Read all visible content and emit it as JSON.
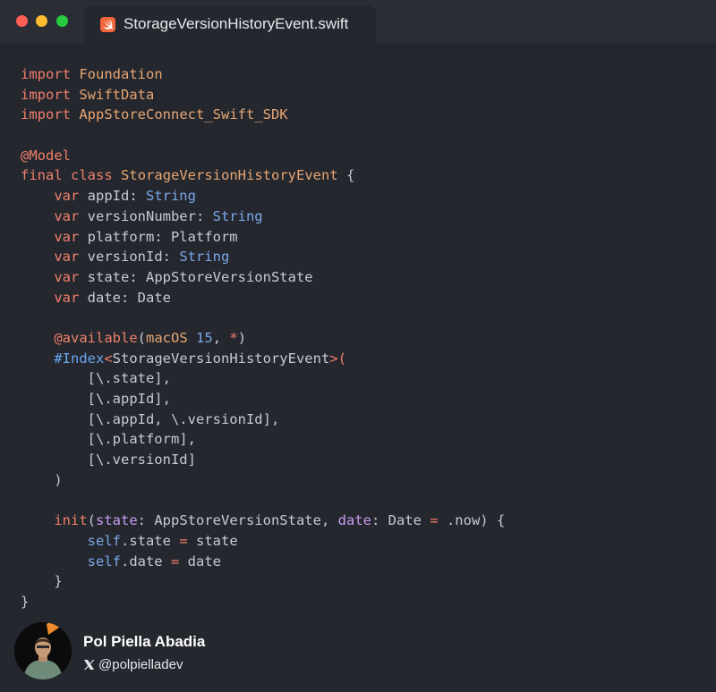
{
  "window": {
    "tab_title": "StorageVersionHistoryEvent.swift",
    "tab_icon": "swift-icon"
  },
  "code": {
    "lines": [
      [
        {
          "t": "import",
          "c": "kw"
        },
        {
          "t": " "
        },
        {
          "t": "Foundation",
          "c": "imp"
        }
      ],
      [
        {
          "t": "import",
          "c": "kw"
        },
        {
          "t": " "
        },
        {
          "t": "SwiftData",
          "c": "imp"
        }
      ],
      [
        {
          "t": "import",
          "c": "kw"
        },
        {
          "t": " "
        },
        {
          "t": "AppStoreConnect_Swift_SDK",
          "c": "imp"
        }
      ],
      [],
      [
        {
          "t": "@Model",
          "c": "attr"
        }
      ],
      [
        {
          "t": "final",
          "c": "kw"
        },
        {
          "t": " "
        },
        {
          "t": "class",
          "c": "kw"
        },
        {
          "t": " "
        },
        {
          "t": "StorageVersionHistoryEvent",
          "c": "imp"
        },
        {
          "t": " {"
        }
      ],
      [
        {
          "t": "    "
        },
        {
          "t": "var",
          "c": "kw"
        },
        {
          "t": " appId: "
        },
        {
          "t": "String",
          "c": "ty"
        }
      ],
      [
        {
          "t": "    "
        },
        {
          "t": "var",
          "c": "kw"
        },
        {
          "t": " versionNumber: "
        },
        {
          "t": "String",
          "c": "ty"
        }
      ],
      [
        {
          "t": "    "
        },
        {
          "t": "var",
          "c": "kw"
        },
        {
          "t": " platform: Platform"
        }
      ],
      [
        {
          "t": "    "
        },
        {
          "t": "var",
          "c": "kw"
        },
        {
          "t": " versionId: "
        },
        {
          "t": "String",
          "c": "ty"
        }
      ],
      [
        {
          "t": "    "
        },
        {
          "t": "var",
          "c": "kw"
        },
        {
          "t": " state: AppStoreVersionState"
        }
      ],
      [
        {
          "t": "    "
        },
        {
          "t": "var",
          "c": "kw"
        },
        {
          "t": " date: Date"
        }
      ],
      [],
      [
        {
          "t": "    "
        },
        {
          "t": "@available",
          "c": "attr"
        },
        {
          "t": "("
        },
        {
          "t": "macOS",
          "c": "imp"
        },
        {
          "t": " "
        },
        {
          "t": "15",
          "c": "ty"
        },
        {
          "t": ", "
        },
        {
          "t": "*",
          "c": "op"
        },
        {
          "t": ")"
        }
      ],
      [
        {
          "t": "    "
        },
        {
          "t": "#Index",
          "c": "idx"
        },
        {
          "t": "<",
          "c": "op"
        },
        {
          "t": "StorageVersionHistoryEvent"
        },
        {
          "t": ">(",
          "c": "op"
        }
      ],
      [
        {
          "t": "        [\\.state],"
        }
      ],
      [
        {
          "t": "        [\\.appId],"
        }
      ],
      [
        {
          "t": "        [\\.appId, \\.versionId],"
        }
      ],
      [
        {
          "t": "        [\\.platform],"
        }
      ],
      [
        {
          "t": "        [\\.versionId]"
        }
      ],
      [
        {
          "t": "    )"
        }
      ],
      [],
      [
        {
          "t": "    "
        },
        {
          "t": "init",
          "c": "kw"
        },
        {
          "t": "("
        },
        {
          "t": "state",
          "c": "lbl"
        },
        {
          "t": ": AppStoreVersionState, "
        },
        {
          "t": "date",
          "c": "lbl"
        },
        {
          "t": ": Date "
        },
        {
          "t": "=",
          "c": "op"
        },
        {
          "t": " .now) {"
        }
      ],
      [
        {
          "t": "        "
        },
        {
          "t": "self",
          "c": "ty"
        },
        {
          "t": ".state "
        },
        {
          "t": "=",
          "c": "op"
        },
        {
          "t": " state"
        }
      ],
      [
        {
          "t": "        "
        },
        {
          "t": "self",
          "c": "ty"
        },
        {
          "t": ".date "
        },
        {
          "t": "=",
          "c": "op"
        },
        {
          "t": " date"
        }
      ],
      [
        {
          "t": "    }"
        }
      ],
      [
        {
          "t": "}"
        }
      ]
    ]
  },
  "author": {
    "name": "Pol Piella Abadia",
    "handle": "@polpielladev",
    "handle_icon": "x-logo-icon"
  },
  "colors": {
    "background": "#24272e",
    "keyword": "#f0806b",
    "identifier": "#e8a672",
    "type": "#7aa7e8",
    "label": "#c99bf0"
  }
}
